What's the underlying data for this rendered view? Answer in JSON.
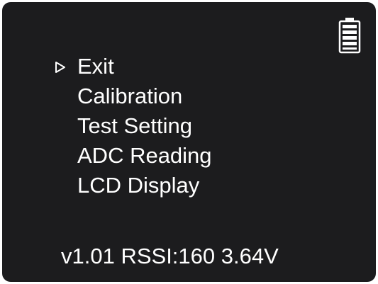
{
  "menu": {
    "selected_index": 0,
    "items": [
      {
        "label": "Exit"
      },
      {
        "label": "Calibration"
      },
      {
        "label": "Test Setting"
      },
      {
        "label": "ADC Reading"
      },
      {
        "label": "LCD Display"
      }
    ]
  },
  "status": {
    "text": "v1.01 RSSI:160 3.64V"
  },
  "icons": {
    "battery": "battery-full-icon",
    "cursor": "triangle-right-outline-icon"
  },
  "colors": {
    "screen_background": "#1c1c1e",
    "foreground": "#ffffff",
    "page_background": "#ffffff"
  }
}
